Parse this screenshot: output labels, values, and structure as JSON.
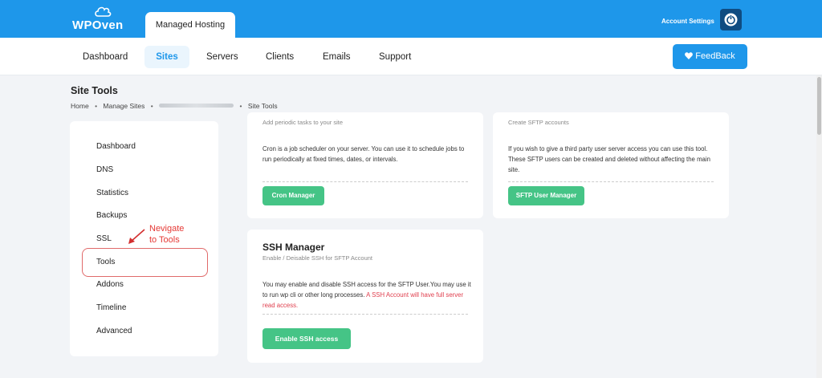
{
  "brand": {
    "logo_text": "WPOven",
    "colors": {
      "primary": "#1e97ea",
      "green": "#45c486",
      "annotation_red": "#e53935"
    }
  },
  "header": {
    "active_tab": "Managed Hosting",
    "account_label": "Account Settings",
    "avatar_icon": "power-icon"
  },
  "nav": {
    "items": [
      "Dashboard",
      "Sites",
      "Servers",
      "Clients",
      "Emails",
      "Support"
    ],
    "active": "Sites",
    "feedback_label": "FeedBack",
    "feedback_icon": "heart-icon"
  },
  "page": {
    "title": "Site Tools",
    "breadcrumb": [
      "Home",
      "Manage Sites",
      "Site Tools"
    ]
  },
  "sidebar": {
    "items": [
      "Dashboard",
      "DNS",
      "Statistics",
      "Backups",
      "SSL",
      "Tools",
      "Addons",
      "Timeline",
      "Advanced"
    ],
    "highlighted": "Tools"
  },
  "annotation": {
    "line1": "Nevigate",
    "line2": "to Tools"
  },
  "cards": {
    "cron": {
      "subtitle": "Add periodic tasks to your site",
      "description": "Cron is a job scheduler on your server. You can use it to schedule jobs to run periodically at fixed times, dates, or intervals.",
      "button": "Cron Manager"
    },
    "sftp": {
      "subtitle": "Create SFTP accounts",
      "description": "If you wish to give a third party user server access you can use this tool. These SFTP users can be created and deleted without affecting the main site.",
      "button": "SFTP User Manager"
    },
    "ssh": {
      "title": "SSH Manager",
      "subtitle": "Enable / Deisable SSH for SFTP Account",
      "description": "You may enable and disable SSH access for the SFTP User.You may use it to run wp cli or other long processes.",
      "warning": "A SSH Account will have full server read access.",
      "button": "Enable SSH access"
    }
  }
}
